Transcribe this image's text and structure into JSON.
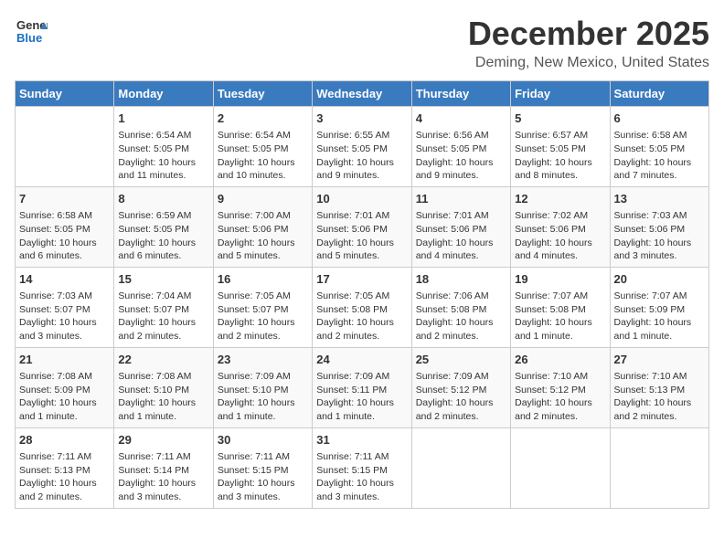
{
  "header": {
    "logo_general": "General",
    "logo_blue": "Blue",
    "month": "December 2025",
    "location": "Deming, New Mexico, United States"
  },
  "calendar": {
    "days_of_week": [
      "Sunday",
      "Monday",
      "Tuesday",
      "Wednesday",
      "Thursday",
      "Friday",
      "Saturday"
    ],
    "weeks": [
      [
        {
          "day": "",
          "info": ""
        },
        {
          "day": "1",
          "info": "Sunrise: 6:54 AM\nSunset: 5:05 PM\nDaylight: 10 hours and 11 minutes."
        },
        {
          "day": "2",
          "info": "Sunrise: 6:54 AM\nSunset: 5:05 PM\nDaylight: 10 hours and 10 minutes."
        },
        {
          "day": "3",
          "info": "Sunrise: 6:55 AM\nSunset: 5:05 PM\nDaylight: 10 hours and 9 minutes."
        },
        {
          "day": "4",
          "info": "Sunrise: 6:56 AM\nSunset: 5:05 PM\nDaylight: 10 hours and 9 minutes."
        },
        {
          "day": "5",
          "info": "Sunrise: 6:57 AM\nSunset: 5:05 PM\nDaylight: 10 hours and 8 minutes."
        },
        {
          "day": "6",
          "info": "Sunrise: 6:58 AM\nSunset: 5:05 PM\nDaylight: 10 hours and 7 minutes."
        }
      ],
      [
        {
          "day": "7",
          "info": "Sunrise: 6:58 AM\nSunset: 5:05 PM\nDaylight: 10 hours and 6 minutes."
        },
        {
          "day": "8",
          "info": "Sunrise: 6:59 AM\nSunset: 5:05 PM\nDaylight: 10 hours and 6 minutes."
        },
        {
          "day": "9",
          "info": "Sunrise: 7:00 AM\nSunset: 5:06 PM\nDaylight: 10 hours and 5 minutes."
        },
        {
          "day": "10",
          "info": "Sunrise: 7:01 AM\nSunset: 5:06 PM\nDaylight: 10 hours and 5 minutes."
        },
        {
          "day": "11",
          "info": "Sunrise: 7:01 AM\nSunset: 5:06 PM\nDaylight: 10 hours and 4 minutes."
        },
        {
          "day": "12",
          "info": "Sunrise: 7:02 AM\nSunset: 5:06 PM\nDaylight: 10 hours and 4 minutes."
        },
        {
          "day": "13",
          "info": "Sunrise: 7:03 AM\nSunset: 5:06 PM\nDaylight: 10 hours and 3 minutes."
        }
      ],
      [
        {
          "day": "14",
          "info": "Sunrise: 7:03 AM\nSunset: 5:07 PM\nDaylight: 10 hours and 3 minutes."
        },
        {
          "day": "15",
          "info": "Sunrise: 7:04 AM\nSunset: 5:07 PM\nDaylight: 10 hours and 2 minutes."
        },
        {
          "day": "16",
          "info": "Sunrise: 7:05 AM\nSunset: 5:07 PM\nDaylight: 10 hours and 2 minutes."
        },
        {
          "day": "17",
          "info": "Sunrise: 7:05 AM\nSunset: 5:08 PM\nDaylight: 10 hours and 2 minutes."
        },
        {
          "day": "18",
          "info": "Sunrise: 7:06 AM\nSunset: 5:08 PM\nDaylight: 10 hours and 2 minutes."
        },
        {
          "day": "19",
          "info": "Sunrise: 7:07 AM\nSunset: 5:08 PM\nDaylight: 10 hours and 1 minute."
        },
        {
          "day": "20",
          "info": "Sunrise: 7:07 AM\nSunset: 5:09 PM\nDaylight: 10 hours and 1 minute."
        }
      ],
      [
        {
          "day": "21",
          "info": "Sunrise: 7:08 AM\nSunset: 5:09 PM\nDaylight: 10 hours and 1 minute."
        },
        {
          "day": "22",
          "info": "Sunrise: 7:08 AM\nSunset: 5:10 PM\nDaylight: 10 hours and 1 minute."
        },
        {
          "day": "23",
          "info": "Sunrise: 7:09 AM\nSunset: 5:10 PM\nDaylight: 10 hours and 1 minute."
        },
        {
          "day": "24",
          "info": "Sunrise: 7:09 AM\nSunset: 5:11 PM\nDaylight: 10 hours and 1 minute."
        },
        {
          "day": "25",
          "info": "Sunrise: 7:09 AM\nSunset: 5:12 PM\nDaylight: 10 hours and 2 minutes."
        },
        {
          "day": "26",
          "info": "Sunrise: 7:10 AM\nSunset: 5:12 PM\nDaylight: 10 hours and 2 minutes."
        },
        {
          "day": "27",
          "info": "Sunrise: 7:10 AM\nSunset: 5:13 PM\nDaylight: 10 hours and 2 minutes."
        }
      ],
      [
        {
          "day": "28",
          "info": "Sunrise: 7:11 AM\nSunset: 5:13 PM\nDaylight: 10 hours and 2 minutes."
        },
        {
          "day": "29",
          "info": "Sunrise: 7:11 AM\nSunset: 5:14 PM\nDaylight: 10 hours and 3 minutes."
        },
        {
          "day": "30",
          "info": "Sunrise: 7:11 AM\nSunset: 5:15 PM\nDaylight: 10 hours and 3 minutes."
        },
        {
          "day": "31",
          "info": "Sunrise: 7:11 AM\nSunset: 5:15 PM\nDaylight: 10 hours and 3 minutes."
        },
        {
          "day": "",
          "info": ""
        },
        {
          "day": "",
          "info": ""
        },
        {
          "day": "",
          "info": ""
        }
      ]
    ]
  }
}
